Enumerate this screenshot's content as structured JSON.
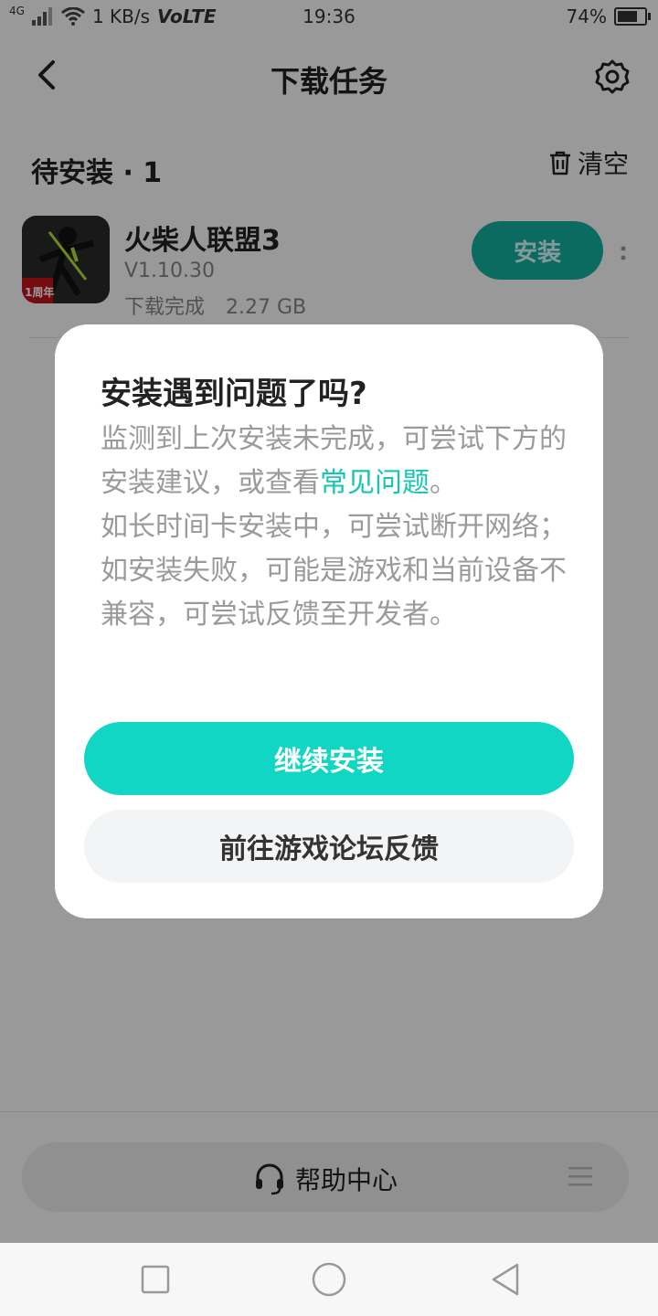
{
  "status_bar": {
    "network": "4G",
    "speed": "1 KB/s",
    "volte": "VoLTE",
    "time": "19:36",
    "battery": "74%",
    "battery_level": 0.74,
    "icons": [
      "signal-icon",
      "wifi-icon",
      "battery-icon"
    ]
  },
  "header": {
    "title": "下载任务",
    "back_icon": "chevron-left-icon",
    "settings_icon": "gear-icon"
  },
  "section": {
    "title": "待安装 · 1",
    "clear_label": "清空",
    "clear_icon": "trash-icon"
  },
  "download_item": {
    "name": "火柴人联盟3",
    "version": "V1.10.30",
    "status": "下载完成",
    "size": "2.27 GB",
    "install_label": "安装",
    "icon_badge_text": "1周年"
  },
  "dialog": {
    "title": "安装遇到问题了吗?",
    "line1_pre": "监测到上次安装未完成，可尝试下方的安装建议，或查看",
    "line1_link": "常见问题",
    "line1_post": "。",
    "line2": "如长时间卡安装中，可尝试断开网络；",
    "line3": "如安装失败，可能是游戏和当前设备不兼容，可尝试反馈至开发者。",
    "primary_label": "继续安装",
    "secondary_label": "前往游戏论坛反馈"
  },
  "help_bar": {
    "label": "帮助中心",
    "icon": "headset-icon",
    "menu_icon": "menu-icon"
  },
  "nav_bar": {
    "icons": [
      "recent-apps-icon",
      "home-icon",
      "back-triangle-icon"
    ]
  },
  "colors": {
    "accent": "#11d6c3",
    "install_button": "#15b3a2",
    "link": "#16c6b4"
  }
}
